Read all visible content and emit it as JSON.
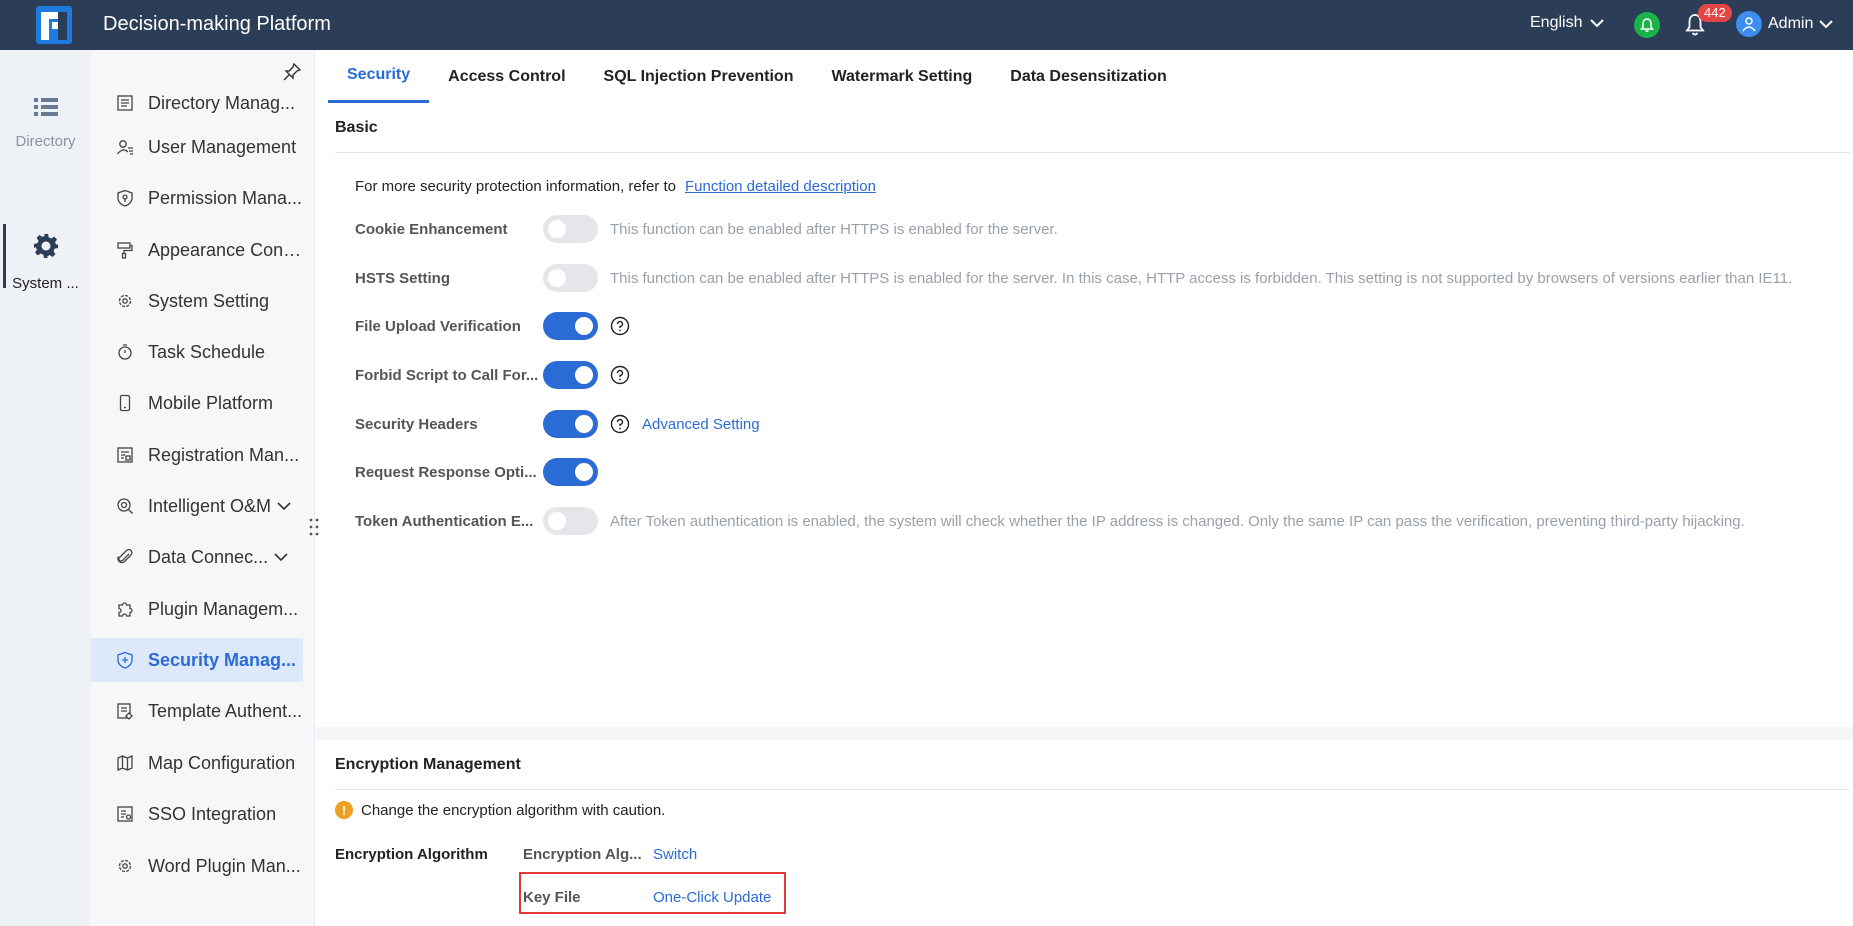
{
  "header": {
    "title": "Decision-making Platform",
    "language": "English",
    "notification_count": "442",
    "user_name": "Admin"
  },
  "rail": {
    "items": [
      {
        "label": "Directory",
        "icon": "list-icon"
      },
      {
        "label": "System ...",
        "icon": "gear-icon"
      }
    ]
  },
  "sidebar": {
    "items": [
      {
        "label": "Directory Manag...",
        "icon": "document-icon"
      },
      {
        "label": "User Management",
        "icon": "user-icon"
      },
      {
        "label": "Permission Mana...",
        "icon": "shield-icon"
      },
      {
        "label": "Appearance Conf...",
        "icon": "paint-roller-icon"
      },
      {
        "label": "System Setting",
        "icon": "gear-icon"
      },
      {
        "label": "Task Schedule",
        "icon": "stopwatch-icon"
      },
      {
        "label": "Mobile Platform",
        "icon": "mobile-icon"
      },
      {
        "label": "Registration Man...",
        "icon": "registration-icon"
      },
      {
        "label": "Intelligent O&M",
        "icon": "om-icon"
      },
      {
        "label": "Data Connec...",
        "icon": "paperclip-icon"
      },
      {
        "label": "Plugin Managem...",
        "icon": "puzzle-icon"
      },
      {
        "label": "Security Manag...",
        "icon": "shield-plus-icon"
      },
      {
        "label": "Template Authent...",
        "icon": "template-icon"
      },
      {
        "label": "Map Configuration",
        "icon": "map-icon"
      },
      {
        "label": "SSO Integration",
        "icon": "sso-icon"
      },
      {
        "label": "Word Plugin Man...",
        "icon": "gear-icon"
      }
    ]
  },
  "tabs": [
    {
      "label": "Security"
    },
    {
      "label": "Access Control"
    },
    {
      "label": "SQL Injection Prevention"
    },
    {
      "label": "Watermark Setting"
    },
    {
      "label": "Data Desensitization"
    }
  ],
  "basic": {
    "title": "Basic",
    "info_text": "For more security protection information, refer to",
    "info_link": "Function detailed description",
    "settings": [
      {
        "label": "Cookie Enhancement",
        "enabled": false,
        "desc": "This function can be enabled after HTTPS is enabled for the server."
      },
      {
        "label": "HSTS Setting",
        "enabled": false,
        "desc": "This function can be enabled after HTTPS is enabled for the server. In this case, HTTP access is forbidden. This setting is not supported by browsers of versions earlier than IE11."
      },
      {
        "label": "File Upload Verification",
        "enabled": true
      },
      {
        "label": "Forbid Script to Call For...",
        "enabled": true
      },
      {
        "label": "Security Headers",
        "enabled": true,
        "link": "Advanced Setting"
      },
      {
        "label": "Request Response Opti...",
        "enabled": true
      },
      {
        "label": "Token Authentication E...",
        "enabled": false,
        "desc": "After Token authentication is enabled, the system will check whether the IP address is changed. Only the same IP can pass the verification, preventing third-party hijacking."
      }
    ]
  },
  "encryption": {
    "title": "Encryption Management",
    "warning": "Change the encryption algorithm with caution.",
    "algorithm_label": "Encryption Algorithm",
    "rows": [
      {
        "key": "Encryption Alg...",
        "action": "Switch"
      },
      {
        "key": "Key File",
        "action": "One-Click Update"
      }
    ]
  },
  "colors": {
    "topbar": "#2c3e57",
    "accent": "#2a6bd6",
    "highlight": "#e53935"
  }
}
